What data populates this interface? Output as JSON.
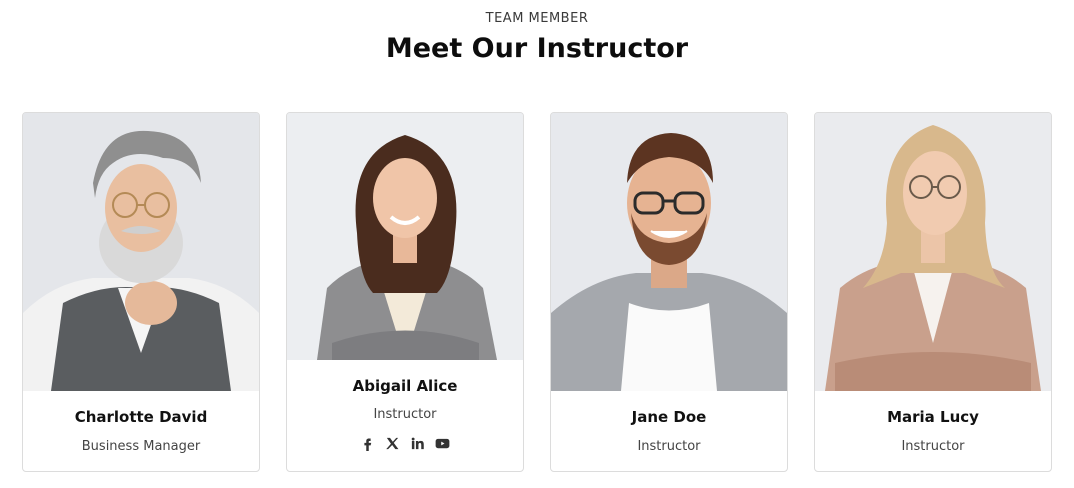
{
  "section": {
    "kicker": "TEAM MEMBER",
    "title": "Meet Our Instructor"
  },
  "team": [
    {
      "name": "Charlotte David",
      "role": "Business Manager"
    },
    {
      "name": "Abigail Alice",
      "role": "Instructor"
    },
    {
      "name": "Jane Doe",
      "role": "Instructor"
    },
    {
      "name": "Maria Lucy",
      "role": "Instructor"
    }
  ],
  "socials": [
    {
      "icon": "facebook-icon"
    },
    {
      "icon": "x-twitter-icon"
    },
    {
      "icon": "linkedin-icon"
    },
    {
      "icon": "youtube-icon"
    }
  ],
  "colors": {
    "icon": "#333333",
    "border": "#dcdcdc"
  }
}
